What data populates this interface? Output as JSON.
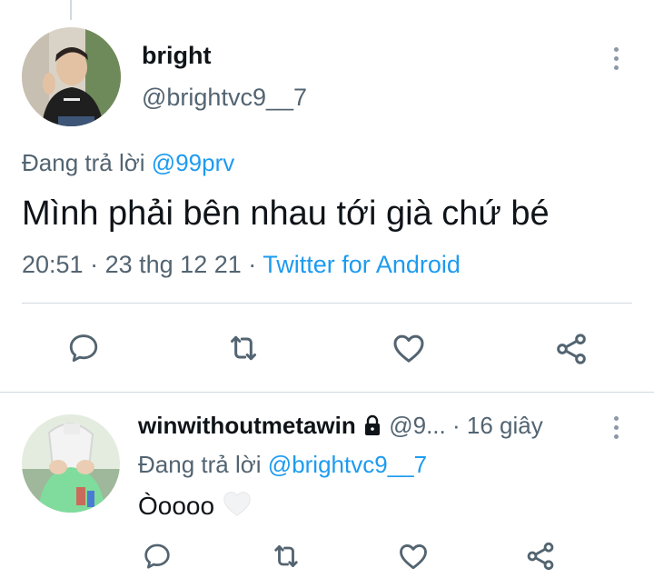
{
  "main_tweet": {
    "display_name": "bright",
    "handle": "@brightvc9__7",
    "replying_prefix": "Đang trả lời",
    "replying_to": "@99prv",
    "text": "Mình phải bên nhau tới già chứ bé",
    "time": "20:51",
    "separator": "·",
    "date": "23 thg 12 21",
    "source": "Twitter for Android"
  },
  "reply_tweet": {
    "display_name": "winwithoutmetawin",
    "handle": "@9...",
    "separator": "·",
    "age": "16 giây",
    "replying_prefix": "Đang trả lời",
    "replying_to": "@brightvc9__7",
    "text": "Òoooo",
    "emoji": "white-heart"
  },
  "icons": {
    "reply": "comment-icon",
    "retweet": "retweet-icon",
    "like": "heart-icon",
    "share": "share-icon",
    "more": "more-vertical-icon",
    "lock": "lock-icon"
  },
  "colors": {
    "accent": "#1d9bf0",
    "secondary_text": "#536471",
    "divider": "#cfd9de"
  }
}
